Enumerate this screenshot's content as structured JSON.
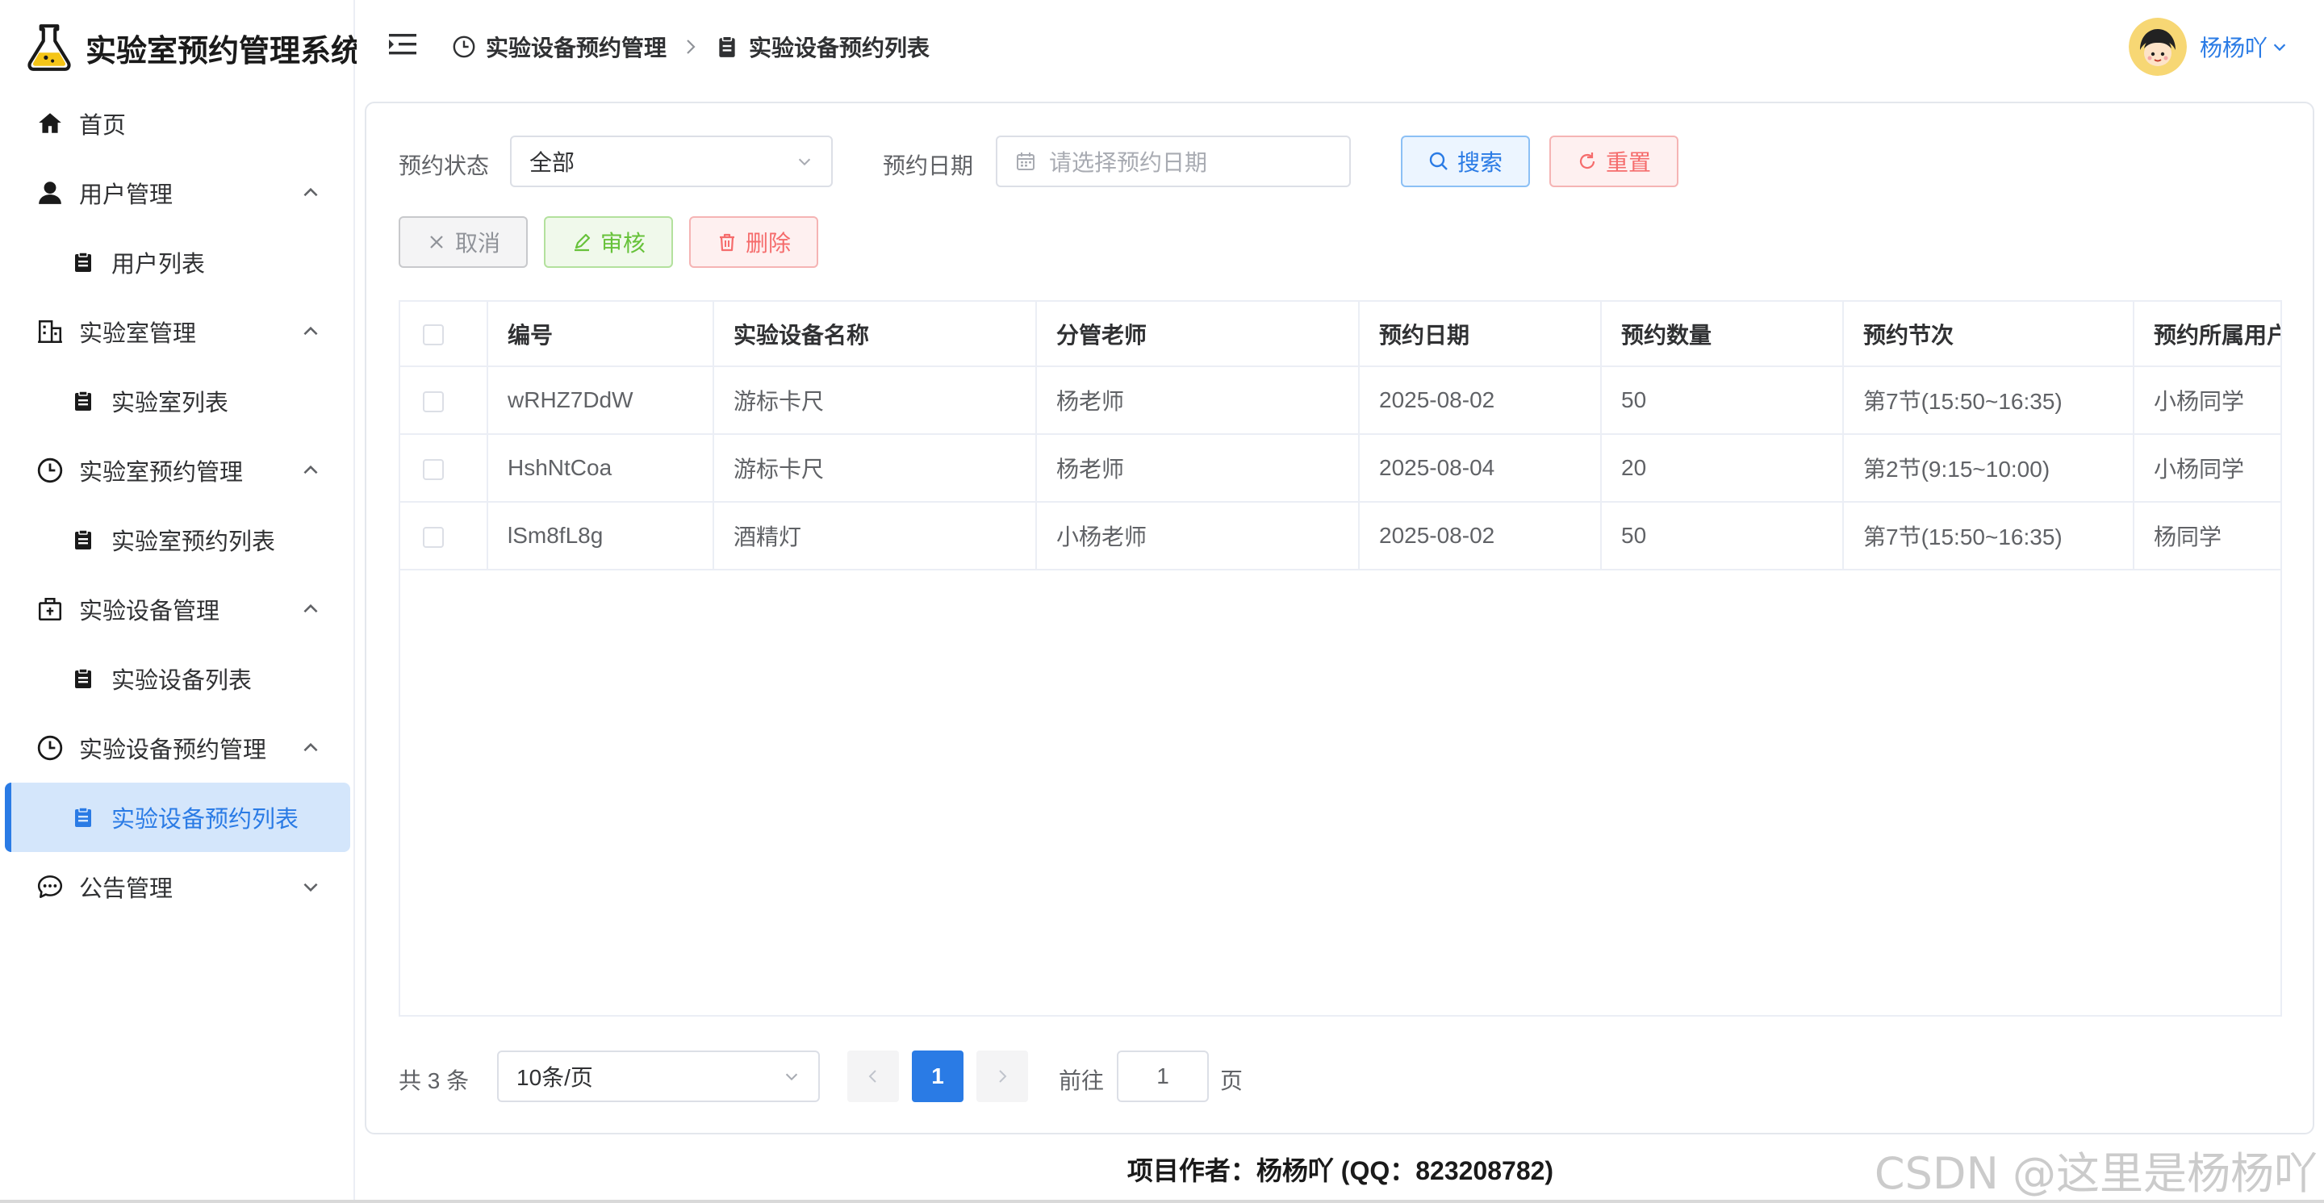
{
  "app": {
    "title": "实验室预约管理系统"
  },
  "sidebar": {
    "items": [
      {
        "label": "首页"
      },
      {
        "label": "用户管理"
      },
      {
        "label": "用户列表"
      },
      {
        "label": "实验室管理"
      },
      {
        "label": "实验室列表"
      },
      {
        "label": "实验室预约管理"
      },
      {
        "label": "实验室预约列表"
      },
      {
        "label": "实验设备管理"
      },
      {
        "label": "实验设备列表"
      },
      {
        "label": "实验设备预约管理"
      },
      {
        "label": "实验设备预约列表"
      },
      {
        "label": "公告管理"
      }
    ],
    "active": "实验设备预约列表",
    "accent_color": "#2a7be5"
  },
  "header": {
    "breadcrumb": [
      "实验设备预约管理",
      "实验设备预约列表"
    ],
    "user_name": "杨杨吖"
  },
  "filters": {
    "status_label": "预约状态",
    "status_value": "全部",
    "date_label": "预约日期",
    "date_placeholder": "请选择预约日期",
    "search_label": "搜索",
    "reset_label": "重置"
  },
  "actions": {
    "cancel_label": "取消",
    "audit_label": "审核",
    "delete_label": "删除"
  },
  "table": {
    "columns": [
      "编号",
      "实验设备名称",
      "分管老师",
      "预约日期",
      "预约数量",
      "预约节次",
      "预约所属用户"
    ],
    "rows": [
      [
        "wRHZ7DdW",
        "游标卡尺",
        "杨老师",
        "2025-08-02",
        "50",
        "第7节(15:50~16:35)",
        "小杨同学"
      ],
      [
        "HshNtCoa",
        "游标卡尺",
        "杨老师",
        "2025-08-04",
        "20",
        "第2节(9:15~10:00)",
        "小杨同学"
      ],
      [
        "lSm8fL8g",
        "酒精灯",
        "小杨老师",
        "2025-08-02",
        "50",
        "第7节(15:50~16:35)",
        "杨同学"
      ]
    ]
  },
  "pagination": {
    "total_text": "共 3 条",
    "page_size": "10条/页",
    "current_page": "1",
    "goto_label": "前往",
    "goto_value": "1",
    "page_suffix": "页"
  },
  "footer": {
    "text": "项目作者：杨杨吖 (QQ：823208782)",
    "watermark": "CSDN @这里是杨杨吖"
  }
}
